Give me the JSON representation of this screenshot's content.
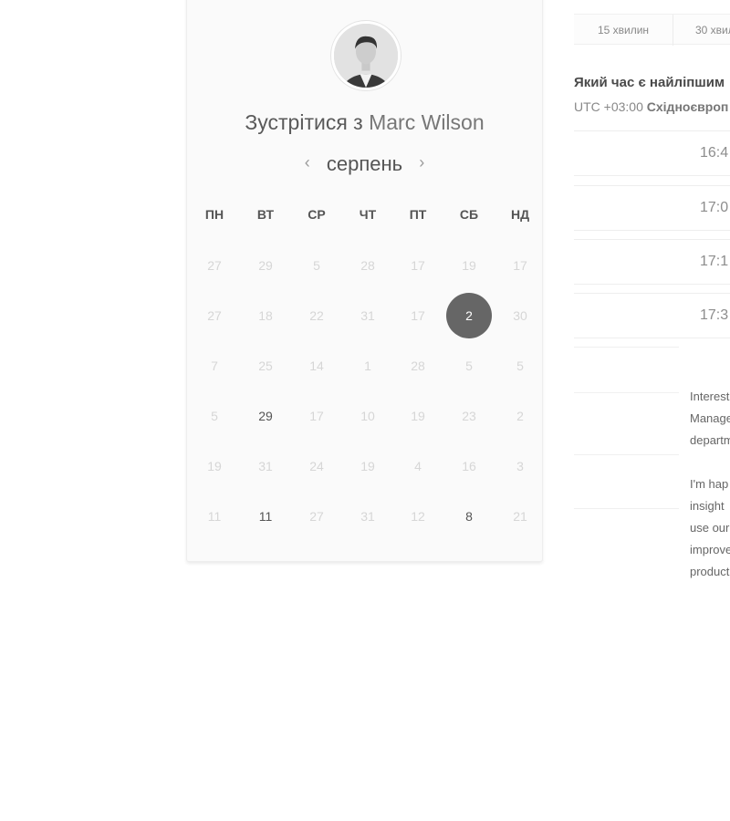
{
  "calendar_card": {
    "title_prefix": "Зустрітися з",
    "host_name": "Marc Wilson",
    "avatar_icon": "user-portrait-icon",
    "month": "серпень",
    "prev_arrow": "‹",
    "next_arrow": "›",
    "weekdays": [
      "ПН",
      "ВТ",
      "СР",
      "ЧТ",
      "ПТ",
      "СБ",
      "НД"
    ],
    "weeks": [
      [
        "27",
        "29",
        "5",
        "28",
        "17",
        "19",
        "17"
      ],
      [
        "27",
        "18",
        "22",
        "31",
        "17",
        "2",
        "30"
      ],
      [
        "7",
        "25",
        "14",
        "1",
        "28",
        "5",
        "5"
      ],
      [
        "5",
        "29",
        "17",
        "10",
        "19",
        "23",
        "2"
      ],
      [
        "19",
        "31",
        "24",
        "19",
        "4",
        "16",
        "3"
      ],
      [
        "11",
        "11",
        "27",
        "31",
        "12",
        "8",
        "21"
      ]
    ],
    "available_days": [
      [
        3,
        1
      ],
      [
        5,
        1
      ],
      [
        5,
        5
      ]
    ],
    "selected_day": [
      1,
      5
    ],
    "colors": {
      "selected_bg": "#666666",
      "unavailable_text": "#d6d6d6",
      "available_text": "#555555"
    }
  },
  "scheduler": {
    "durations": [
      "15 хвилин",
      "30 хвил"
    ],
    "question": "Який час є найліпшим",
    "timezone_offset": "UTC +03:00",
    "timezone_name": "Східноєвроп",
    "time_slots": [
      "16:4",
      "17:0",
      "17:1",
      "17:3"
    ],
    "bio_paragraphs": [
      [
        "Interest",
        "Manage",
        "departm"
      ],
      [
        "I'm hap",
        "insight",
        "use our",
        "improve",
        "product"
      ]
    ]
  }
}
